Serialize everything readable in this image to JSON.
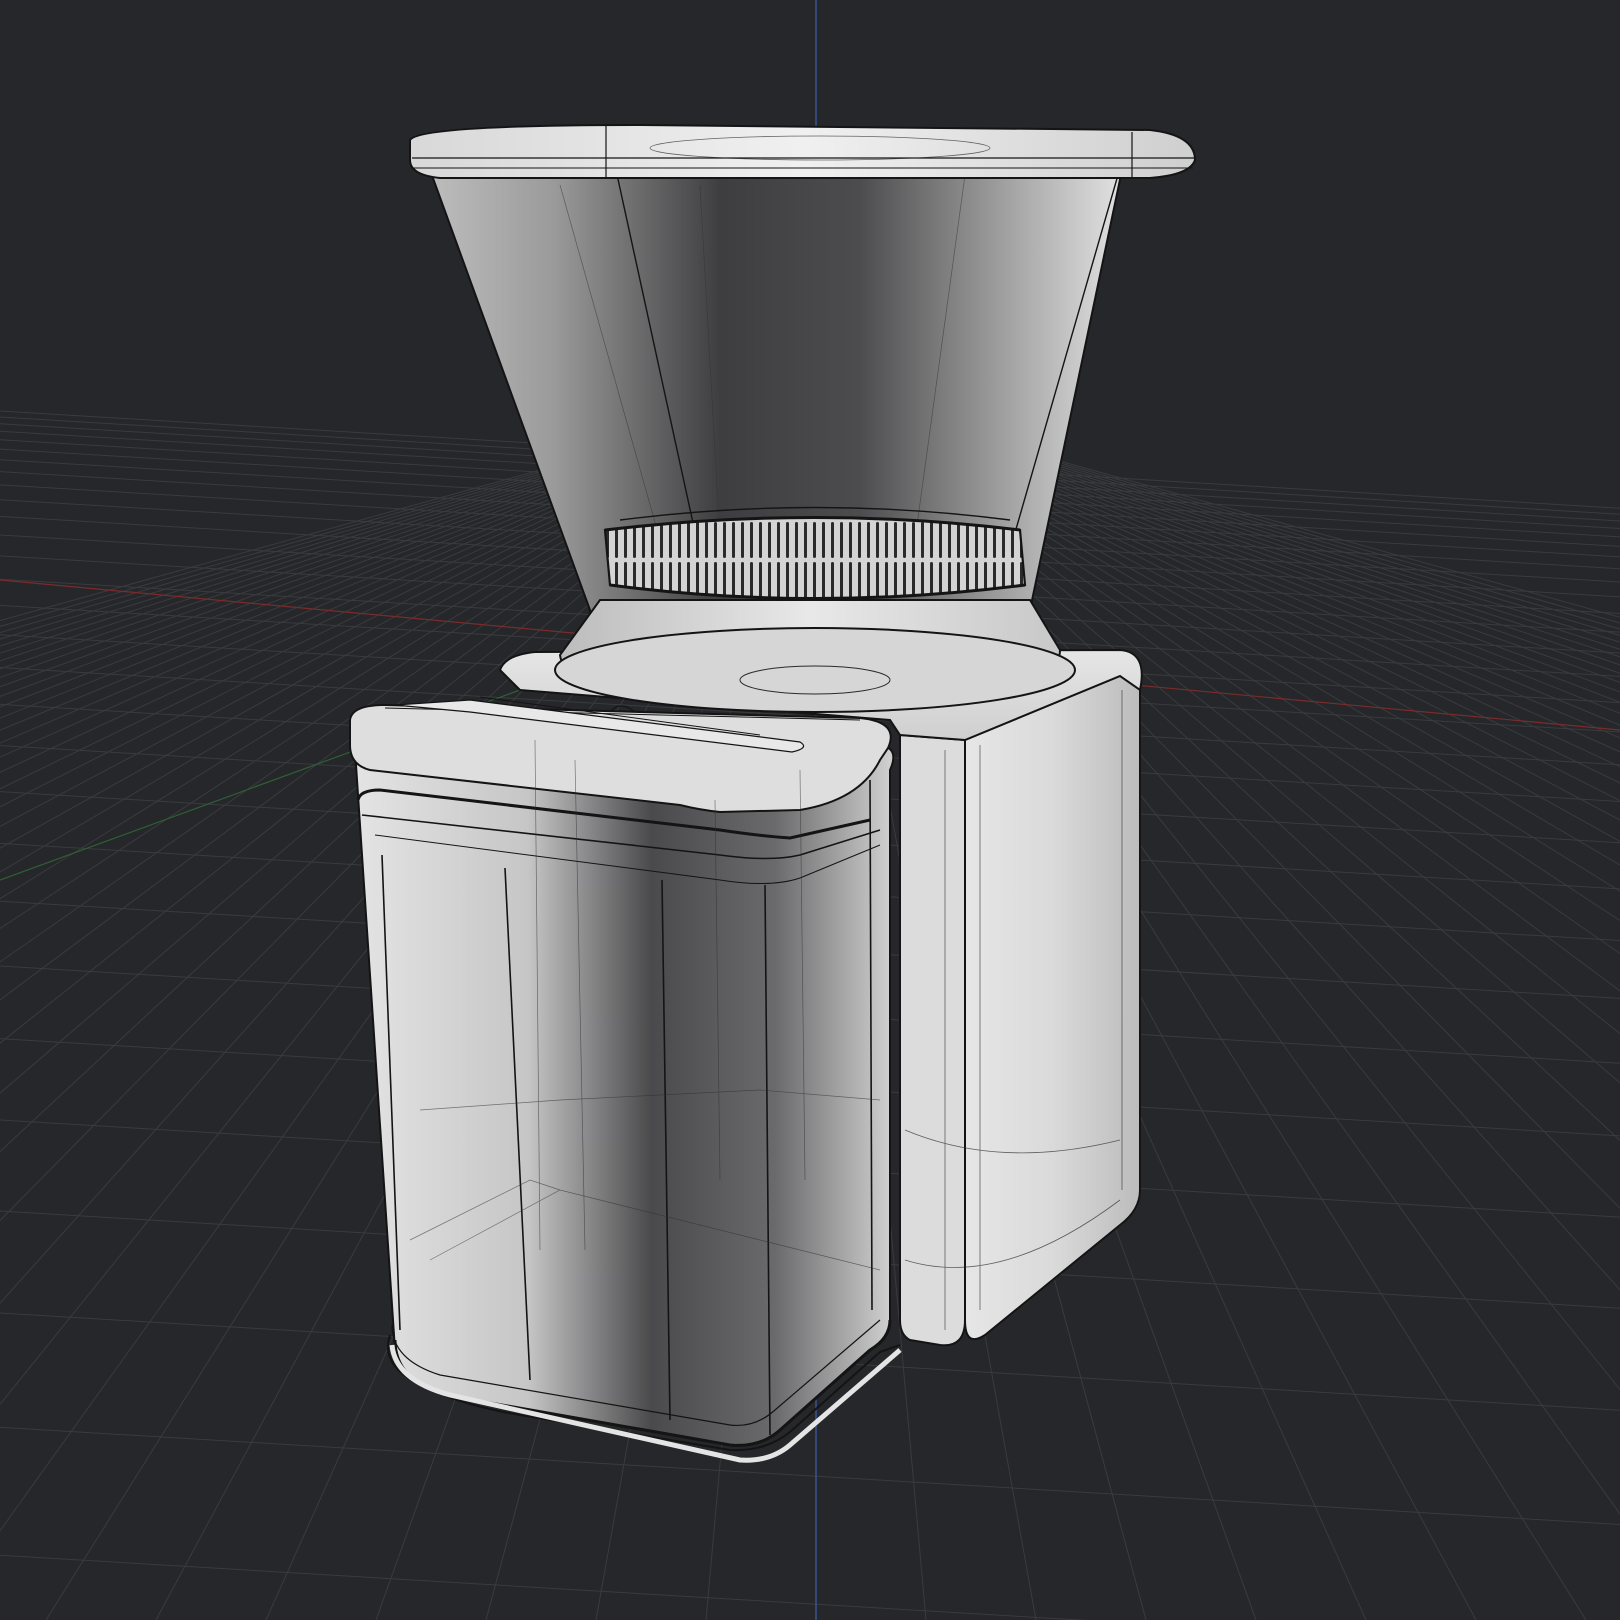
{
  "viewport": {
    "background_color": "#26272a",
    "grid_color": "#3a3b3f",
    "x_axis_color": "#8a2f2f",
    "y_axis_color": "#2f6f3a",
    "z_axis_color": "#3a5fae",
    "model_fill_color": "#c9c9c9",
    "model_shadow_color": "#4a4a4c",
    "wire_color": "#141414"
  },
  "scene": {
    "object_name": "coffee-grinder-model",
    "parts": [
      "hopper",
      "grind-adjustment-ring",
      "grinder-body",
      "grounds-container"
    ]
  }
}
